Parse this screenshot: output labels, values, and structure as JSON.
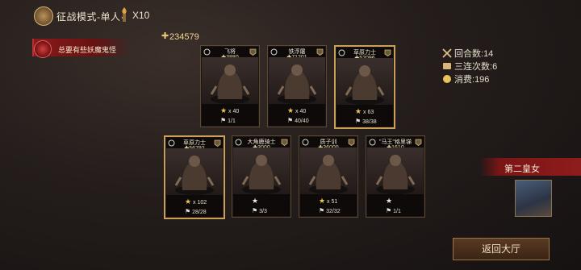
{
  "header": {
    "mode_title": "征战模式-单人·",
    "count": "X10"
  },
  "banner": {
    "text": "总要有些妖魔鬼怪"
  },
  "power": {
    "value": "234579"
  },
  "stats": {
    "rounds_label": "回合数:",
    "rounds_value": "14",
    "triple_label": "三连次数:",
    "triple_value": "6",
    "cost_label": "消费:",
    "cost_value": "196"
  },
  "cards": [
    {
      "name": "飞将",
      "power": "3880",
      "stars": "x 40",
      "star_color": "gold",
      "troops": "1/1",
      "border": "normal"
    },
    {
      "name": "铁浮屠",
      "power": "71201",
      "stars": "x 40",
      "star_color": "gold",
      "troops": "40/40",
      "border": "normal"
    },
    {
      "name": "草原力士",
      "power": "52096",
      "stars": "x 63",
      "star_color": "gold",
      "troops": "38/38",
      "border": "gold"
    },
    {
      "name": "草原力士",
      "power": "56792",
      "stars": "x 102",
      "star_color": "gold",
      "troops": "28/28",
      "border": "gold"
    },
    {
      "name": "大角鹿骑士",
      "power": "3000",
      "stars": "",
      "star_color": "white",
      "troops": "3/3",
      "border": "normal"
    },
    {
      "name": "质子训",
      "power": "36000",
      "stars": "x 51",
      "star_color": "gold",
      "troops": "32/32",
      "border": "normal"
    },
    {
      "name": "\"马王\"格里锑",
      "power": "1610",
      "stars": "",
      "star_color": "white",
      "troops": "1/1",
      "border": "normal"
    }
  ],
  "princess": {
    "name": "第二皇女"
  },
  "buttons": {
    "return": "返回大厅"
  },
  "colors": {
    "gold": "#caa058",
    "banner_red": "#8a1a1a"
  }
}
